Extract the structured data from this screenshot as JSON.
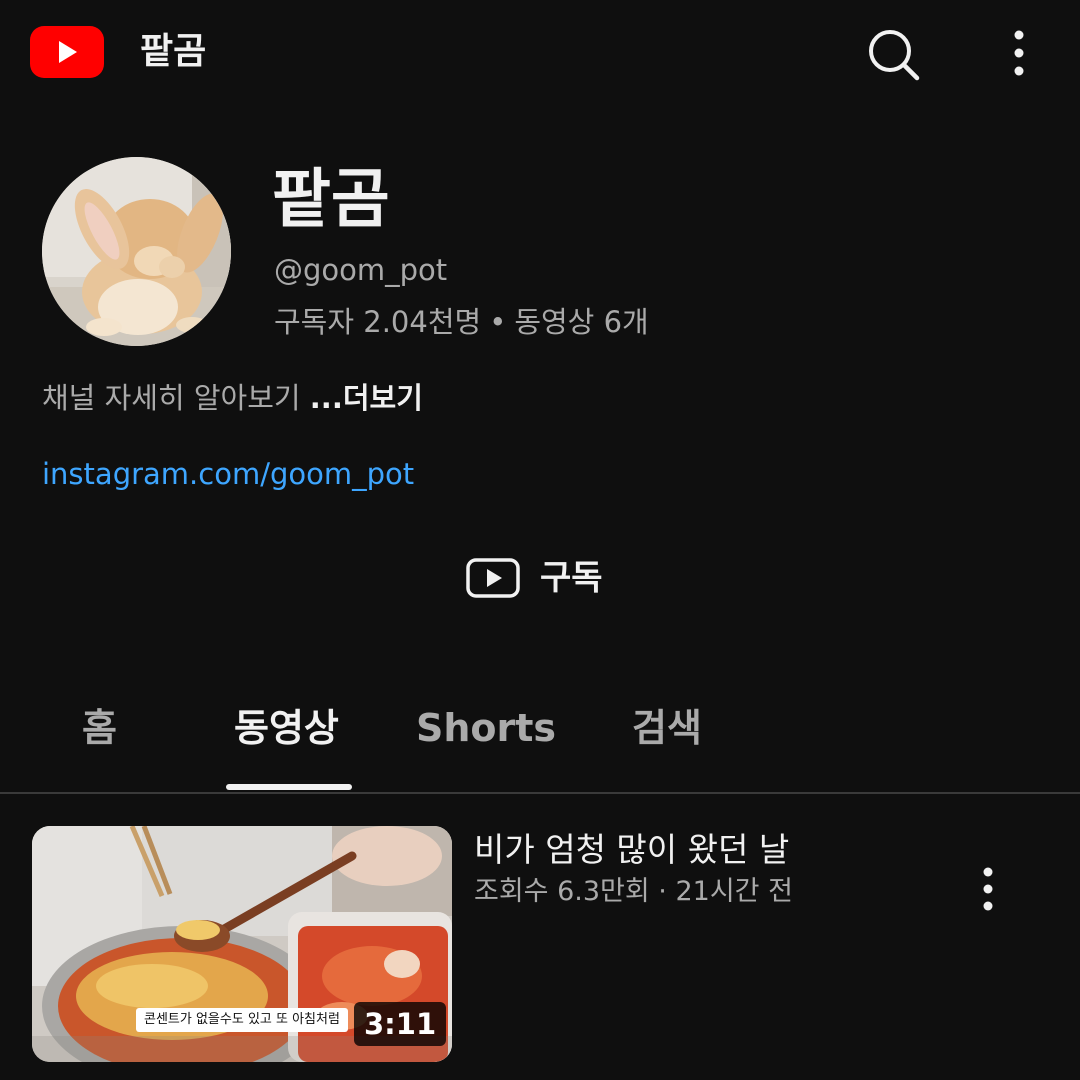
{
  "topbar": {
    "title": "팥곰",
    "logo_icon": "youtube-logo-icon",
    "search_icon": "search-icon",
    "more_icon": "more-vert-icon"
  },
  "channel": {
    "name": "팥곰",
    "handle": "@goom_pot",
    "subscribers": "구독자 2.04천명",
    "separator": "•",
    "videos": "동영상 6개",
    "about": "채널 자세히 알아보기",
    "about_more": "...더보기",
    "link": "instagram.com/goom_pot",
    "avatar": "rabbit-avatar-image"
  },
  "subscribe": {
    "label": "구독",
    "icon": "play-outline-icon"
  },
  "tabs": [
    {
      "label": "홈",
      "active": false
    },
    {
      "label": "동영상",
      "active": true
    },
    {
      "label": "Shorts",
      "active": false
    },
    {
      "label": "검색",
      "active": false
    }
  ],
  "videos": [
    {
      "title": "비가 엄청 많이 왔던 날",
      "meta": "조회수 6.3만회 · 21시간 전",
      "duration": "3:11",
      "caption": "콘센트가 없을수도 있고 또 아침처럼",
      "more_icon": "more-vert-icon"
    }
  ],
  "colors": {
    "background": "#0f0f0f",
    "brand_red": "#ff0000",
    "link_blue": "#3ea6ff",
    "text_primary": "#f1f1f1",
    "text_secondary": "#aaaaaa"
  }
}
